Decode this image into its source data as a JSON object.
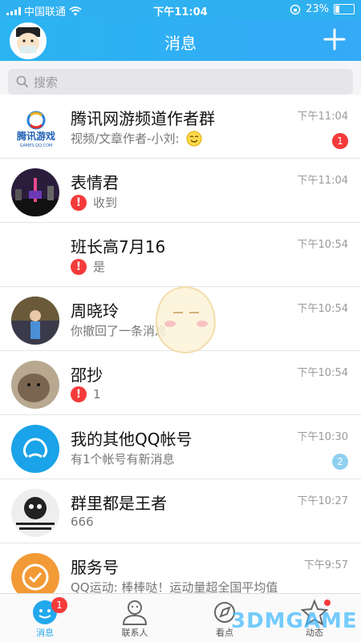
{
  "status_bar": {
    "carrier": "中国联通",
    "time": "下午11:04",
    "battery": "23%"
  },
  "header": {
    "title": "消息",
    "avatar_icon": "profile-avatar",
    "add_icon": "plus-icon"
  },
  "search": {
    "placeholder": "搜索"
  },
  "conversations": [
    {
      "name": "腾讯网游频道作者群",
      "time": "下午11:04",
      "preview": "视频/文章作者-小刘:",
      "badge": "1",
      "badge_color": "#f53a3a",
      "warn": false,
      "logo_text": "腾讯游戏",
      "logo_sub": "GAMES.QQ.COM"
    },
    {
      "name": "表情君",
      "time": "下午11:04",
      "preview": "收到",
      "badge": "",
      "warn": true
    },
    {
      "name": "班长高7月16",
      "time": "下午10:54",
      "preview": "是",
      "badge": "",
      "warn": true
    },
    {
      "name": "周晓玲",
      "time": "下午10:54",
      "preview": "你撤回了一条消息",
      "badge": "",
      "warn": false
    },
    {
      "name": "邵抄",
      "time": "下午10:54",
      "preview": "1",
      "badge": "",
      "warn": true
    },
    {
      "name": "我的其他QQ帐号",
      "time": "下午10:30",
      "preview": "有1个帐号有新消息",
      "badge": "2",
      "badge_color": "#8fd0f0",
      "warn": false
    },
    {
      "name": "群里都是王者",
      "time": "下午10:27",
      "preview": "666",
      "badge": "",
      "warn": false
    },
    {
      "name": "服务号",
      "time": "下午9:57",
      "preview": "QQ运动: 棒棒哒！运动量超全国平均值",
      "badge": "",
      "warn": false
    }
  ],
  "warn_symbol": "!",
  "tabs": [
    {
      "label": "消息",
      "badge": "1",
      "icon": "message-icon",
      "active": true
    },
    {
      "label": "联系人",
      "icon": "contacts-icon"
    },
    {
      "label": "看点",
      "icon": "discover-icon"
    },
    {
      "label": "动态",
      "icon": "star-icon"
    }
  ],
  "watermark": "3DMGAME",
  "colors": {
    "accent": "#2fb0f0",
    "badge_red": "#f53a3a",
    "active_tab": "#22a8ec"
  }
}
